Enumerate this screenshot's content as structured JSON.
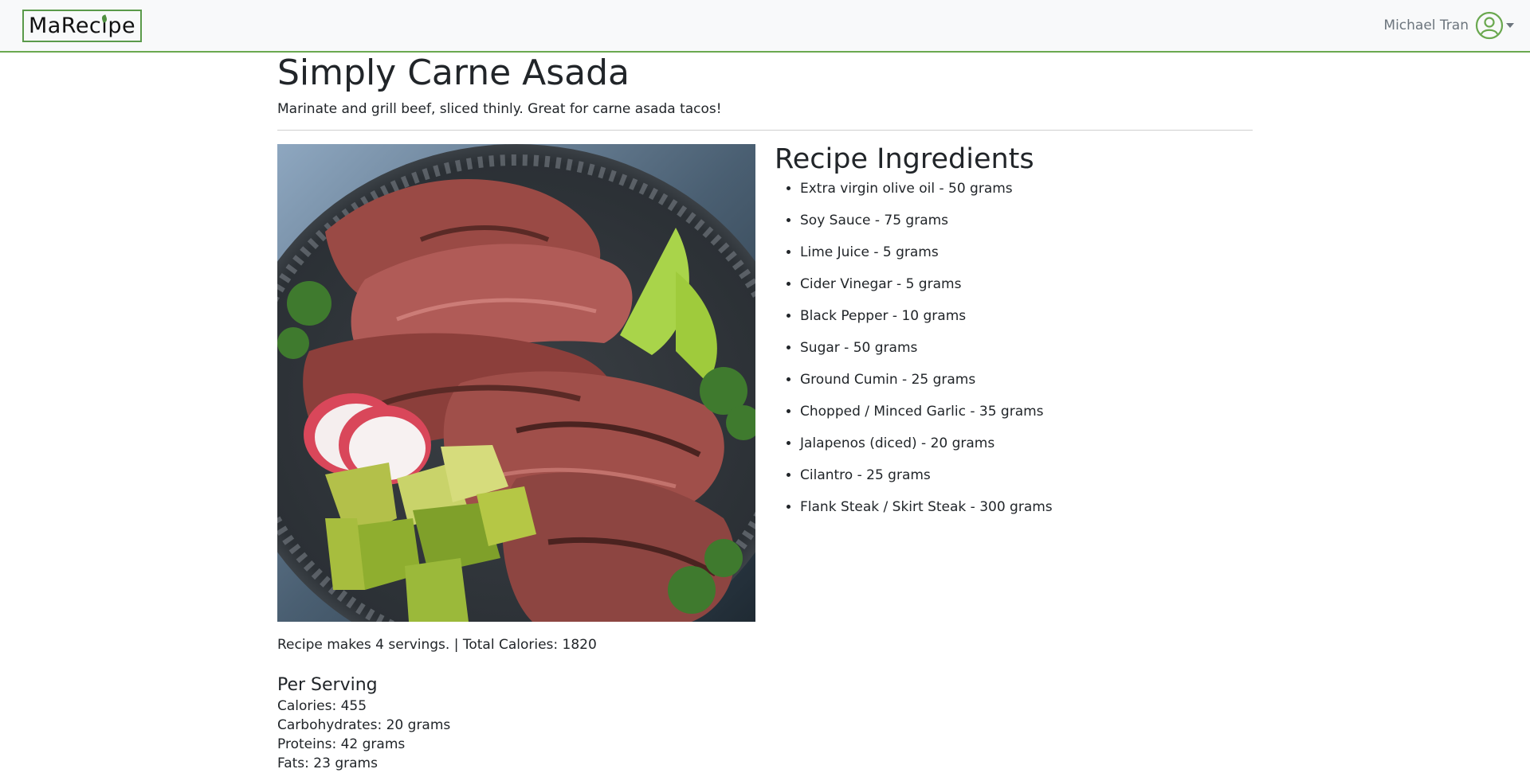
{
  "navbar": {
    "brand": {
      "part1": "MaRec",
      "part2": "i",
      "part3": "pe"
    },
    "user_name": "Michael Tran",
    "accent_color": "#6aa84f"
  },
  "recipe": {
    "title": "Simply Carne Asada",
    "description": "Marinate and grill beef, sliced thinly. Great for carne asada tacos!",
    "image_icon": "carne-asada-photo",
    "ingredients_title": "Recipe Ingredients",
    "ingredients": [
      "Extra virgin olive oil - 50 grams",
      "Soy Sauce - 75 grams",
      "Lime Juice - 5 grams",
      "Cider Vinegar - 5 grams",
      "Black Pepper - 10 grams",
      "Sugar - 50 grams",
      "Ground Cumin - 25 grams",
      "Chopped / Minced Garlic - 35 grams",
      "Jalapenos (diced) - 20 grams",
      "Cilantro - 25 grams",
      "Flank Steak / Skirt Steak - 300 grams"
    ],
    "servings_line": "Recipe makes 4 servings. | Total Calories: 1820",
    "per_serving": {
      "title": "Per Serving",
      "calories": "Calories: 455",
      "carbohydrates": "Carbohydrates: 20 grams",
      "proteins": "Proteins: 42 grams",
      "fats": "Fats: 23 grams"
    }
  }
}
